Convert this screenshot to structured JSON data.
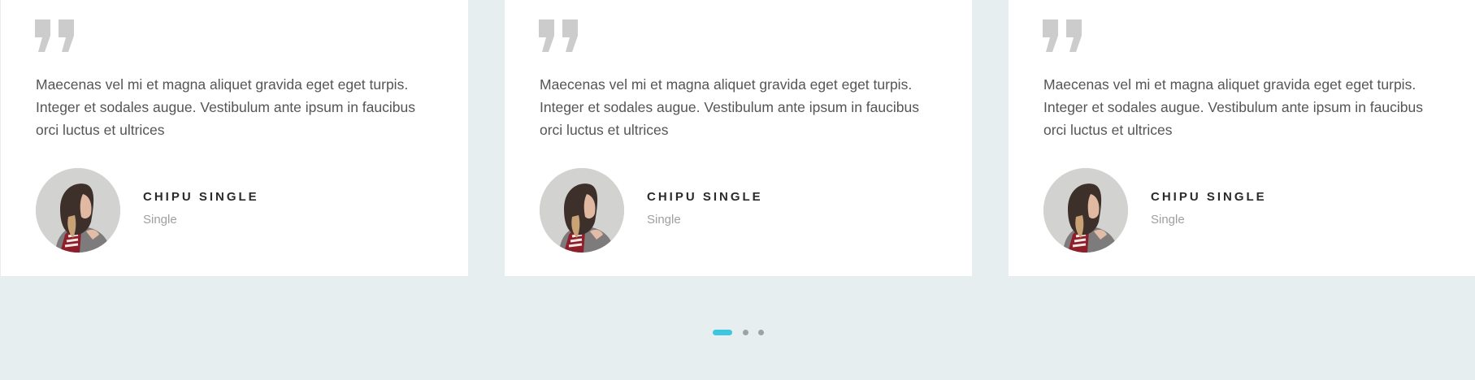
{
  "testimonials": [
    {
      "quote": "Maecenas vel mi et magna aliquet gravida eget eget turpis. Integer et sodales augue. Vestibulum ante ipsum in faucibus orci luctus et ultrices",
      "name": "CHIPU SINGLE",
      "role": "Single",
      "quote_icon": "quote-icon",
      "avatar_icon": "avatar-photo"
    },
    {
      "quote": "Maecenas vel mi et magna aliquet gravida eget eget turpis. Integer et sodales augue. Vestibulum ante ipsum in faucibus orci luctus et ultrices",
      "name": "CHIPU SINGLE",
      "role": "Single",
      "quote_icon": "quote-icon",
      "avatar_icon": "avatar-photo"
    },
    {
      "quote": "Maecenas vel mi et magna aliquet gravida eget eget turpis. Integer et sodales augue. Vestibulum ante ipsum in faucibus orci luctus et ultrices",
      "name": "CHIPU SINGLE",
      "role": "Single",
      "quote_icon": "quote-icon",
      "avatar_icon": "avatar-photo"
    }
  ],
  "pager": {
    "active_index": 0,
    "count": 3
  },
  "colors": {
    "background": "#e6eef0",
    "card": "#ffffff",
    "accent": "#3ec6e0",
    "dot_inactive": "#9aa3a6",
    "quote_mark": "#cccccc"
  }
}
